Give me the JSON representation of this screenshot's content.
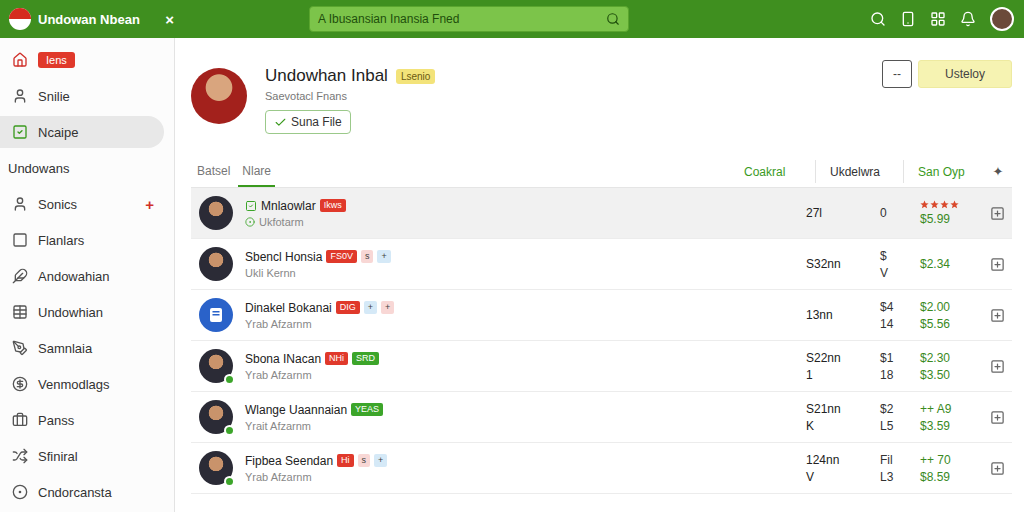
{
  "window": {
    "title": "Undowan Nbean",
    "close": "×"
  },
  "search": {
    "placeholder": "A Ibusansian Inansia Fned"
  },
  "sidebar": {
    "items": [
      {
        "kind": "badge",
        "label": "Iens",
        "selected": false
      },
      {
        "kind": "item",
        "label": "Snilie",
        "selected": false
      },
      {
        "kind": "item",
        "label": "Ncaipe",
        "selected": true
      },
      {
        "kind": "header",
        "label": "Undowans",
        "selected": false
      },
      {
        "kind": "item",
        "label": "Sonics",
        "selected": false,
        "action": "+"
      },
      {
        "kind": "item",
        "label": "Flanlars",
        "selected": false
      },
      {
        "kind": "item",
        "label": "Andowahian",
        "selected": false
      },
      {
        "kind": "item",
        "label": "Undowhian",
        "selected": false
      },
      {
        "kind": "item",
        "label": "Samnlaia",
        "selected": false
      },
      {
        "kind": "item",
        "label": "Venmodlags",
        "selected": false
      },
      {
        "kind": "item",
        "label": "Panss",
        "selected": false
      },
      {
        "kind": "item",
        "label": "Sfiniral",
        "selected": false
      },
      {
        "kind": "item",
        "label": "Cndorcansta",
        "selected": false
      }
    ]
  },
  "profile": {
    "name": "Undowhan Inbal",
    "badge": "Lsenio",
    "subtitle": "Saevotacl Fnans",
    "button": "Suna File"
  },
  "actions": [
    {
      "label": "--",
      "kind": "outline"
    },
    {
      "label": "Usteloy",
      "kind": "primary"
    }
  ],
  "table": {
    "tabs": [
      {
        "label": "Batsel",
        "selected": false
      },
      {
        "label": "Nlare",
        "selected": true
      }
    ],
    "columns": [
      {
        "label": "Coakral",
        "color": "#3a9a1e"
      },
      {
        "label": "Ukdelwra",
        "color": "#333333"
      },
      {
        "label": "San Oyp",
        "color": "#3a9a1e"
      }
    ],
    "add": "✦",
    "rows": [
      {
        "name": "Mnlaowlar",
        "avatar": "photo",
        "verified": true,
        "online": false,
        "selected": true,
        "tags": [
          {
            "label": "Ikws",
            "color": "#e0392b"
          }
        ],
        "subtitle": "Ukfotarm",
        "col1": [
          "27l"
        ],
        "col2": [
          "0"
        ],
        "stars": 4,
        "right": [
          "$5.99"
        ]
      },
      {
        "name": "Sbencl Honsia",
        "avatar": "photo",
        "verified": false,
        "online": false,
        "selected": false,
        "tags": [
          {
            "label": "FS0V",
            "color": "#e0392b"
          },
          {
            "label": "s",
            "color": "#f8d7d5"
          },
          {
            "label": "+",
            "color": "#d5e9f7"
          }
        ],
        "subtitle": "Ukli Kernn",
        "col1": [
          "S32nn"
        ],
        "col2": [
          "$",
          "V"
        ],
        "stars": 0,
        "right": [
          "$2.34"
        ]
      },
      {
        "name": "Dinakel Bokanai",
        "avatar": "icon",
        "verified": false,
        "online": false,
        "selected": false,
        "tags": [
          {
            "label": "DIG",
            "color": "#e0392b"
          },
          {
            "label": "+",
            "color": "#d5e9f7"
          },
          {
            "label": "+",
            "color": "#f8d7d5"
          }
        ],
        "subtitle": "Yrab Afzarnm",
        "col1": [
          "13nn"
        ],
        "col2": [
          "$4",
          "14"
        ],
        "stars": 0,
        "right": [
          "$2.00",
          "$5.56"
        ]
      },
      {
        "name": "Sbona INacan",
        "avatar": "photo",
        "verified": false,
        "online": true,
        "selected": false,
        "tags": [
          {
            "label": "NHi",
            "color": "#e0392b"
          },
          {
            "label": "SRD",
            "color": "#3ca52a"
          }
        ],
        "subtitle": "Yrab Afzarnm",
        "col1": [
          "S22nn",
          "1"
        ],
        "col2": [
          "$1",
          "18"
        ],
        "stars": 0,
        "right": [
          "$2.30",
          "$3.50"
        ]
      },
      {
        "name": "Wlange Uaannaian",
        "avatar": "photo",
        "verified": false,
        "online": true,
        "selected": false,
        "tags": [
          {
            "label": "YEAS",
            "color": "#3ca52a"
          }
        ],
        "subtitle": "Yrait Afzarnm",
        "col1": [
          "S21nn",
          "K"
        ],
        "col2": [
          "$2",
          "L5"
        ],
        "stars": 0,
        "right": [
          "++ A9",
          "$3.59"
        ]
      },
      {
        "name": "Fipbea Seendan",
        "avatar": "photo",
        "verified": false,
        "online": true,
        "selected": false,
        "tags": [
          {
            "label": "Hi",
            "color": "#e0392b"
          },
          {
            "label": "s",
            "color": "#f8d7d5"
          },
          {
            "label": "+",
            "color": "#d5e9f7"
          }
        ],
        "subtitle": "Yrab Afzarnm",
        "col1": [
          "124nn",
          "V"
        ],
        "col2": [
          "Fil",
          "L3"
        ],
        "stars": 0,
        "right": [
          "++ 70",
          "$8.59"
        ]
      }
    ]
  }
}
